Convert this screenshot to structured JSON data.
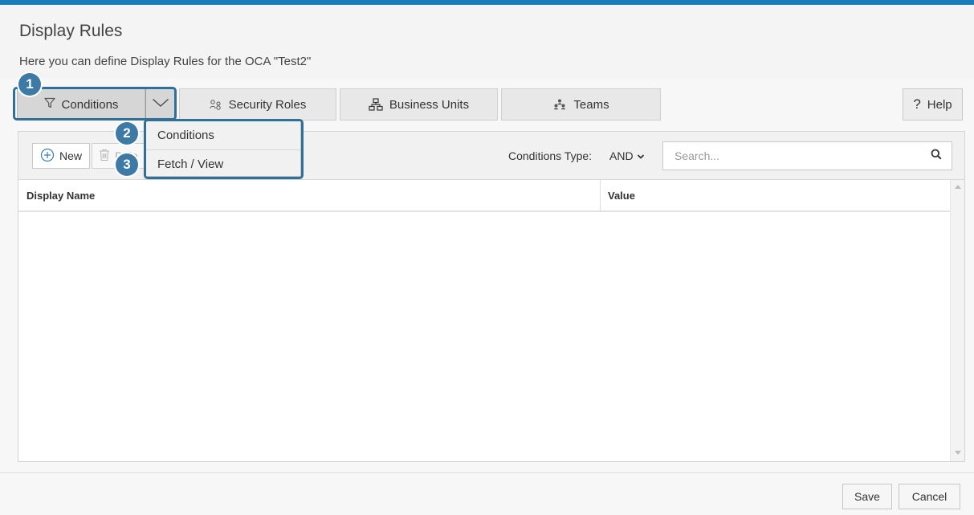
{
  "page": {
    "title": "Display Rules",
    "subtitle": "Here you can define Display Rules for the OCA \"Test2\""
  },
  "tabs": {
    "conditions": {
      "label": "Conditions",
      "icon": "filter-icon"
    },
    "security_roles": {
      "label": "Security Roles",
      "icon": "security-roles-icon"
    },
    "business_units": {
      "label": "Business Units",
      "icon": "hierarchy-icon"
    },
    "teams": {
      "label": "Teams",
      "icon": "teams-icon"
    }
  },
  "help": {
    "label": "Help",
    "glyph": "?"
  },
  "dropdown": {
    "items": [
      {
        "label": "Conditions"
      },
      {
        "label": "Fetch / View"
      }
    ]
  },
  "callouts": [
    "1",
    "2",
    "3"
  ],
  "toolbar": {
    "new_label": "New",
    "delete_label": "Dele",
    "conditions_type_label": "Conditions Type:",
    "conditions_type_value": "AND",
    "search_placeholder": "Search..."
  },
  "grid": {
    "columns": [
      "Display Name",
      "Value"
    ],
    "rows": []
  },
  "footer": {
    "save_label": "Save",
    "cancel_label": "Cancel"
  },
  "colors": {
    "accent": "#1a7bb9",
    "callout": "#3d7aa5",
    "callout_border": "#2f6f98"
  }
}
